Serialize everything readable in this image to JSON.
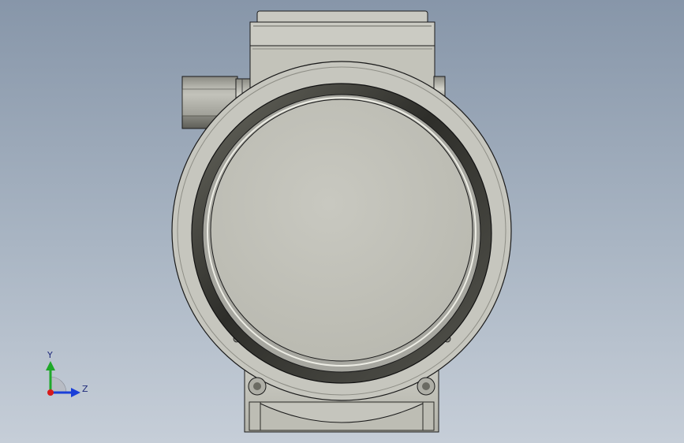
{
  "viewport": {
    "background_top": "#8796a9",
    "background_bottom": "#c6ced8"
  },
  "model": {
    "body_color": "#c2c2b8",
    "face_color": "#c4c4bc",
    "ring_dark": "#3a3a34",
    "edge_color": "#1a1a1a"
  },
  "triad": {
    "y_label": "Y",
    "z_label": "Z",
    "y_color": "#1fa82a",
    "z_color": "#1a3fd8",
    "origin_color": "#d81a1a"
  }
}
